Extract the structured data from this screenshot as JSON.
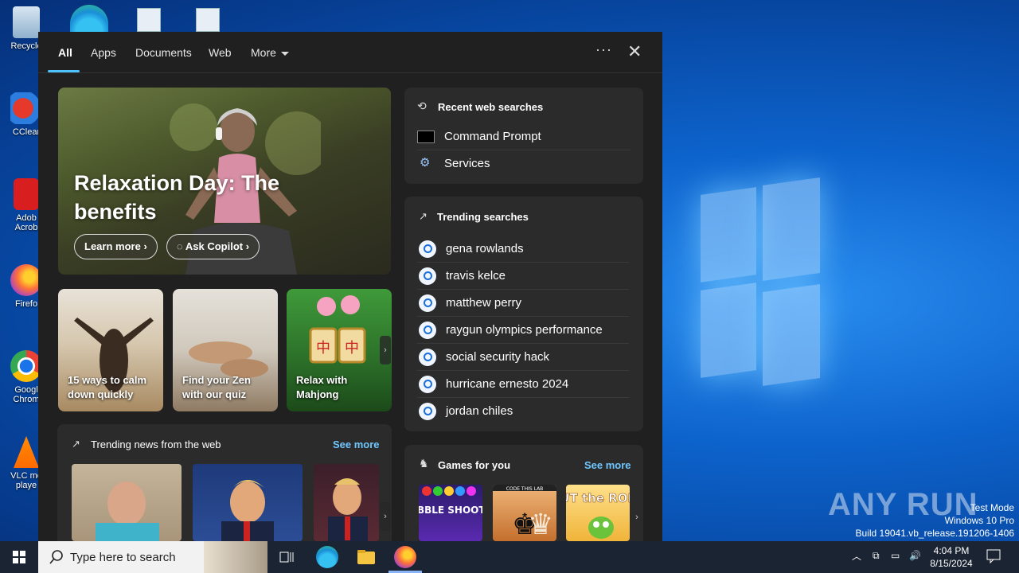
{
  "desktop": {
    "icons": [
      {
        "label": "Recycle",
        "name": "recycle-bin"
      },
      {
        "label": "CClear",
        "name": "ccleaner"
      },
      {
        "label": "Adob Acrob",
        "name": "adobe-acrobat"
      },
      {
        "label": "Firefo",
        "name": "firefox"
      },
      {
        "label": "Googl Chrom",
        "name": "google-chrome"
      },
      {
        "label": "VLC me playe",
        "name": "vlc"
      }
    ],
    "watermark": {
      "line1": "Test Mode",
      "line2": "Windows 10 Pro",
      "line3": "Build 19041.vb_release.191206-1406"
    },
    "brand": "ANY RUN"
  },
  "search_panel": {
    "tabs": [
      {
        "label": "All",
        "active": true
      },
      {
        "label": "Apps"
      },
      {
        "label": "Documents"
      },
      {
        "label": "Web"
      },
      {
        "label": "More"
      }
    ],
    "more_menu": "···",
    "close": "✕",
    "hero": {
      "title": "Relaxation Day: The benefits",
      "learn_more": "Learn more",
      "ask_copilot": "Ask Copilot"
    },
    "cards": [
      {
        "label": "15 ways to calm down quickly"
      },
      {
        "label": "Find your Zen with our quiz"
      },
      {
        "label": "Relax with Mahjong"
      }
    ],
    "recent": {
      "title": "Recent web searches",
      "items": [
        "Command Prompt",
        "Services"
      ]
    },
    "trending": {
      "title": "Trending searches",
      "items": [
        "gena rowlands",
        "travis kelce",
        "matthew perry",
        "raygun olympics performance",
        "social security hack",
        "hurricane ernesto 2024",
        "jordan chiles"
      ]
    },
    "news": {
      "title": "Trending news from the web",
      "see_more": "See more"
    },
    "games": {
      "title": "Games for you",
      "see_more": "See more",
      "items": [
        "BUBBLE SHOOTER",
        "CODE THIS LAB",
        "CUT the ROPE"
      ]
    }
  },
  "taskbar": {
    "search_placeholder": "Type here to search",
    "time": "4:04 PM",
    "date": "8/15/2024"
  }
}
